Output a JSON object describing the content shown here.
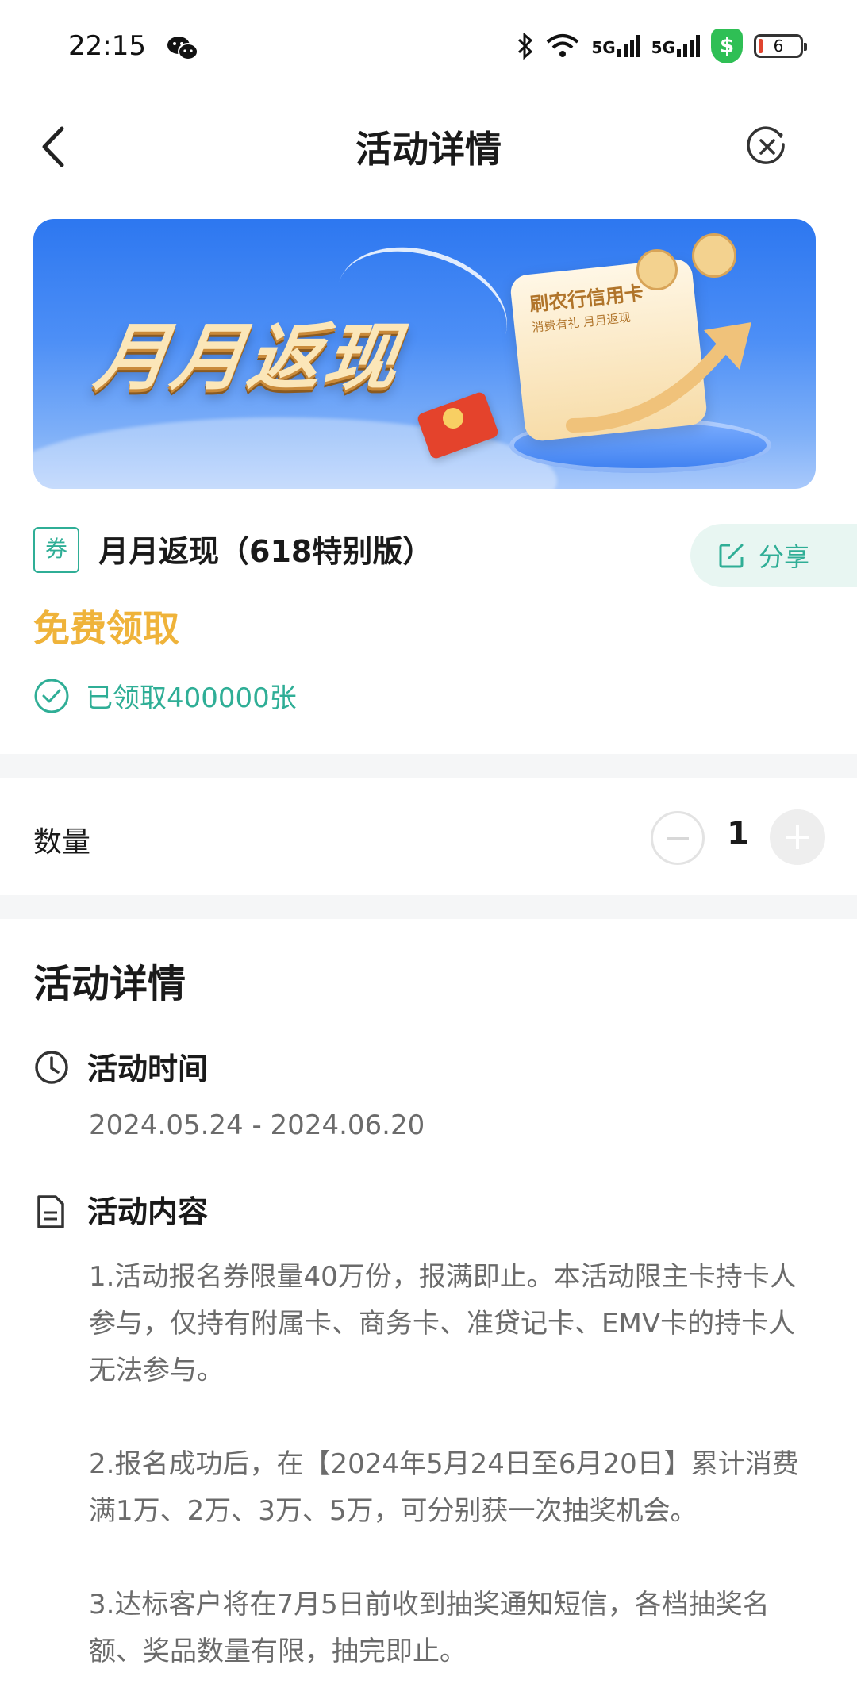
{
  "status_bar": {
    "time": "22:15",
    "network_1": "5G",
    "network_2": "5G",
    "battery": "6"
  },
  "nav": {
    "title": "活动详情"
  },
  "banner": {
    "title": "月月返现",
    "card_title": "刷农行信用卡",
    "card_sub": "消费有礼  月月返现"
  },
  "coupon": {
    "tag": "券",
    "title": "月月返现（618特别版）",
    "share_label": "分享",
    "price": "免费领取",
    "claimed": "已领取400000张"
  },
  "quantity": {
    "label": "数量",
    "value": "1"
  },
  "details": {
    "section_title": "活动详情",
    "time_title": "活动时间",
    "time_range": "2024.05.24 - 2024.06.20",
    "content_title": "活动内容",
    "content_text": "1.活动报名券限量40万份，报满即止。本活动限主卡持卡人参与，仅持有附属卡、商务卡、准贷记卡、EMV卡的持卡人无法参与。\n\n2.报名成功后，在【2024年5月24日至6月20日】累计消费满1万、2万、3万、5万，可分别获一次抽奖机会。\n\n3.达标客户将在7月5日前收到抽奖通知短信，各档抽奖名额、奖品数量有限，抽完即止。"
  },
  "colors": {
    "accent_green": "#2fae96",
    "price_gold": "#efb33a"
  }
}
